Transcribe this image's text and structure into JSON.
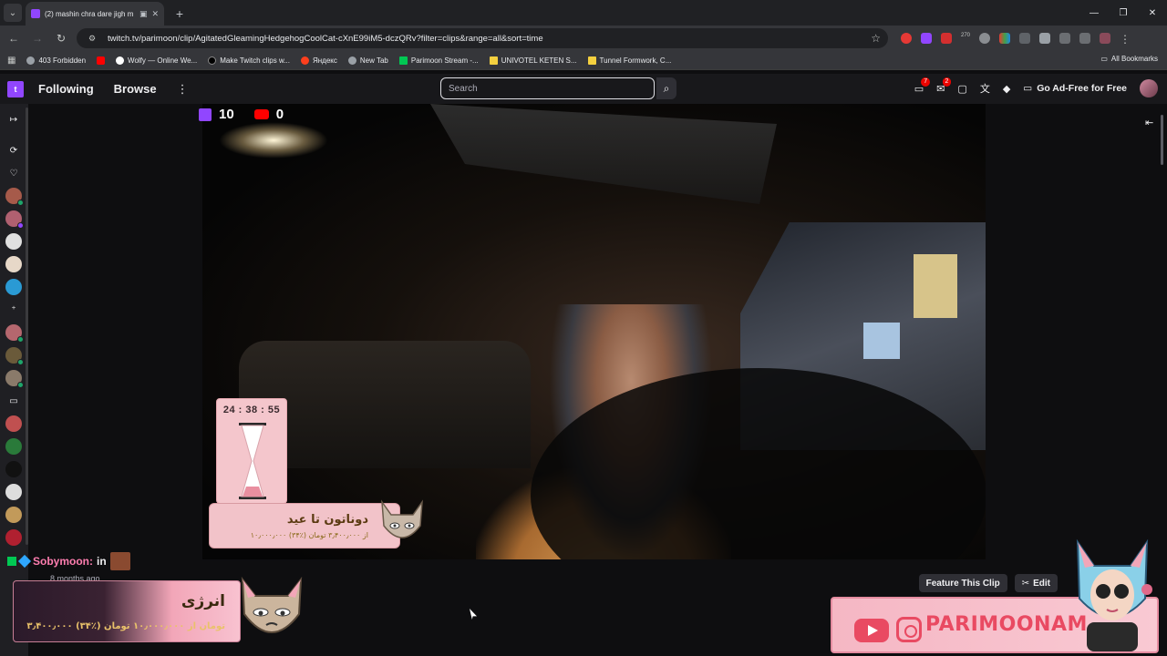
{
  "browser": {
    "tab_title": "(2) mashin chra dare jigh m",
    "url": "twitch.tv/parimoon/clip/AgitatedGleamingHedgehogCoolCat-cXnE99iM5-dczQRv?filter=clips&range=all&sort=time",
    "ext_badge": "270",
    "bookmarks": [
      {
        "label": "403 Forbidden",
        "color": "#9aa0a6"
      },
      {
        "label": "",
        "color": "#ff0000"
      },
      {
        "label": "Wolfy — Online We...",
        "color": "#ffffff"
      },
      {
        "label": "Make Twitch clips w...",
        "color": "#000000"
      },
      {
        "label": "Яндекс",
        "color": "#fc3f1d"
      },
      {
        "label": "New Tab",
        "color": "#9aa0a6"
      },
      {
        "label": "Parimoon Stream -...",
        "color": "#00c853"
      },
      {
        "label": "UNIVOTEL KETEN S...",
        "color": "#f4d03f"
      },
      {
        "label": "Tunnel Formwork, C...",
        "color": "#f4d03f"
      }
    ],
    "all_bookmarks": "All Bookmarks"
  },
  "twitch": {
    "nav": {
      "following": "Following",
      "browse": "Browse"
    },
    "search_placeholder": "Search",
    "notifications": {
      "inbox_count": "7",
      "whispers_count": "2"
    },
    "ad_free": "Go Ad-Free for Free",
    "accent": "#9146ff"
  },
  "video": {
    "twitch_count": "10",
    "youtube_count": "0",
    "timer": "24 : 38 : 55",
    "donation_title": "دوناتون تا عید",
    "donation_sub": "۱۰٫۰۰۰٫۰۰۰ از ۳٫۴۰۰٫۰۰۰ تومان (٪۳۴)"
  },
  "chat": {
    "username": "Sobymoon:",
    "message": "in",
    "time_ago": "8 months ago"
  },
  "energy": {
    "title": "انرژی",
    "subtitle": "۳٫۴۰۰٫۰۰۰ تومان از ۱۰٫۰۰۰٫۰۰۰ تومان (٪۳۴)"
  },
  "actions": {
    "feature": "Feature This Clip",
    "edit": "Edit"
  },
  "social": {
    "handle": "PARIMOONAM"
  }
}
